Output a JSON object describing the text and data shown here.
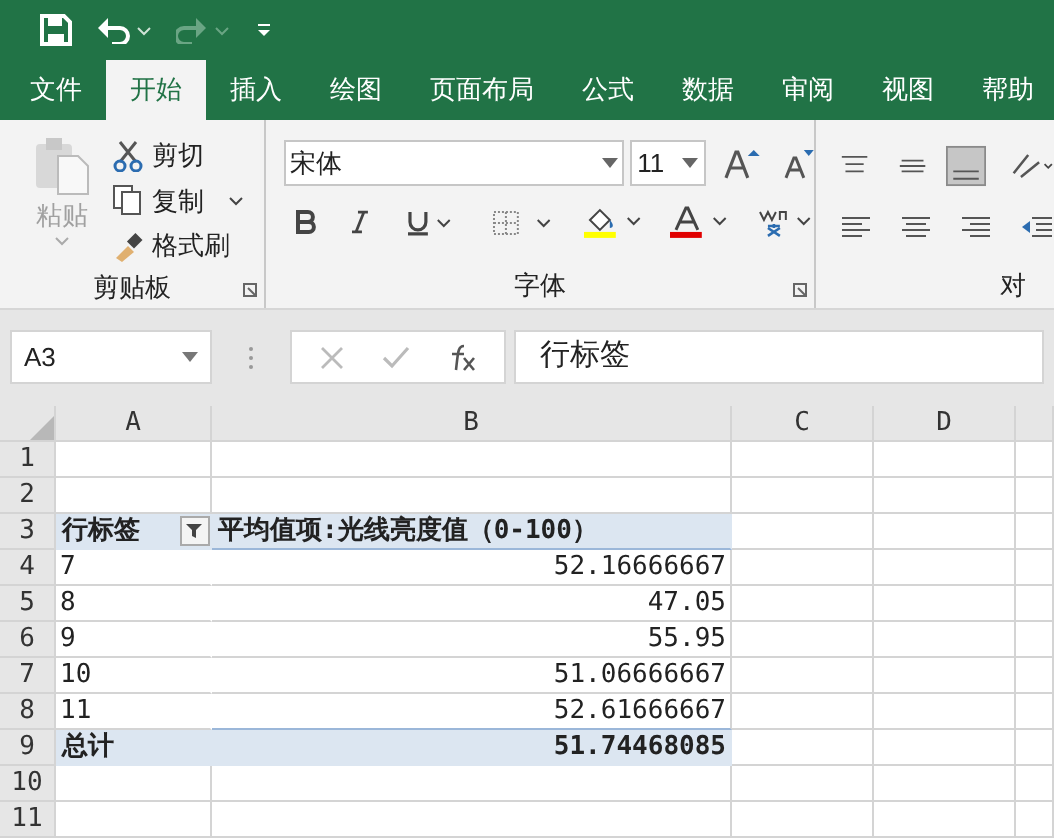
{
  "tabs": [
    {
      "label": "文件",
      "selected": false
    },
    {
      "label": "开始",
      "selected": true
    },
    {
      "label": "插入",
      "selected": false
    },
    {
      "label": "绘图",
      "selected": false
    },
    {
      "label": "页面布局",
      "selected": false
    },
    {
      "label": "公式",
      "selected": false
    },
    {
      "label": "数据",
      "selected": false
    },
    {
      "label": "审阅",
      "selected": false
    },
    {
      "label": "视图",
      "selected": false
    },
    {
      "label": "帮助",
      "selected": false
    }
  ],
  "clipboard": {
    "paste": "粘贴",
    "cut": "剪切",
    "copy": "复制",
    "format_painter": "格式刷",
    "group_label": "剪贴板"
  },
  "font": {
    "font_name": "宋体",
    "font_size": "11",
    "group_label": "字体"
  },
  "alignment": {
    "group_label": "对"
  },
  "formula_bar": {
    "name_box": "A3",
    "formula": "行标签"
  },
  "columns": [
    "A",
    "B",
    "C",
    "D"
  ],
  "row_numbers": [
    "1",
    "2",
    "3",
    "4",
    "5",
    "6",
    "7",
    "8",
    "9",
    "10",
    "11"
  ],
  "pivot": {
    "header": {
      "row_label": "行标签",
      "value_label": "平均值项:光线亮度值（0-100）"
    },
    "rows": [
      {
        "label": "7",
        "value": "52.16666667"
      },
      {
        "label": "8",
        "value": "47.05"
      },
      {
        "label": "9",
        "value": "55.95"
      },
      {
        "label": "10",
        "value": "51.06666667"
      },
      {
        "label": "11",
        "value": "52.61666667"
      }
    ],
    "total": {
      "label": "总计",
      "value": "51.74468085"
    }
  }
}
